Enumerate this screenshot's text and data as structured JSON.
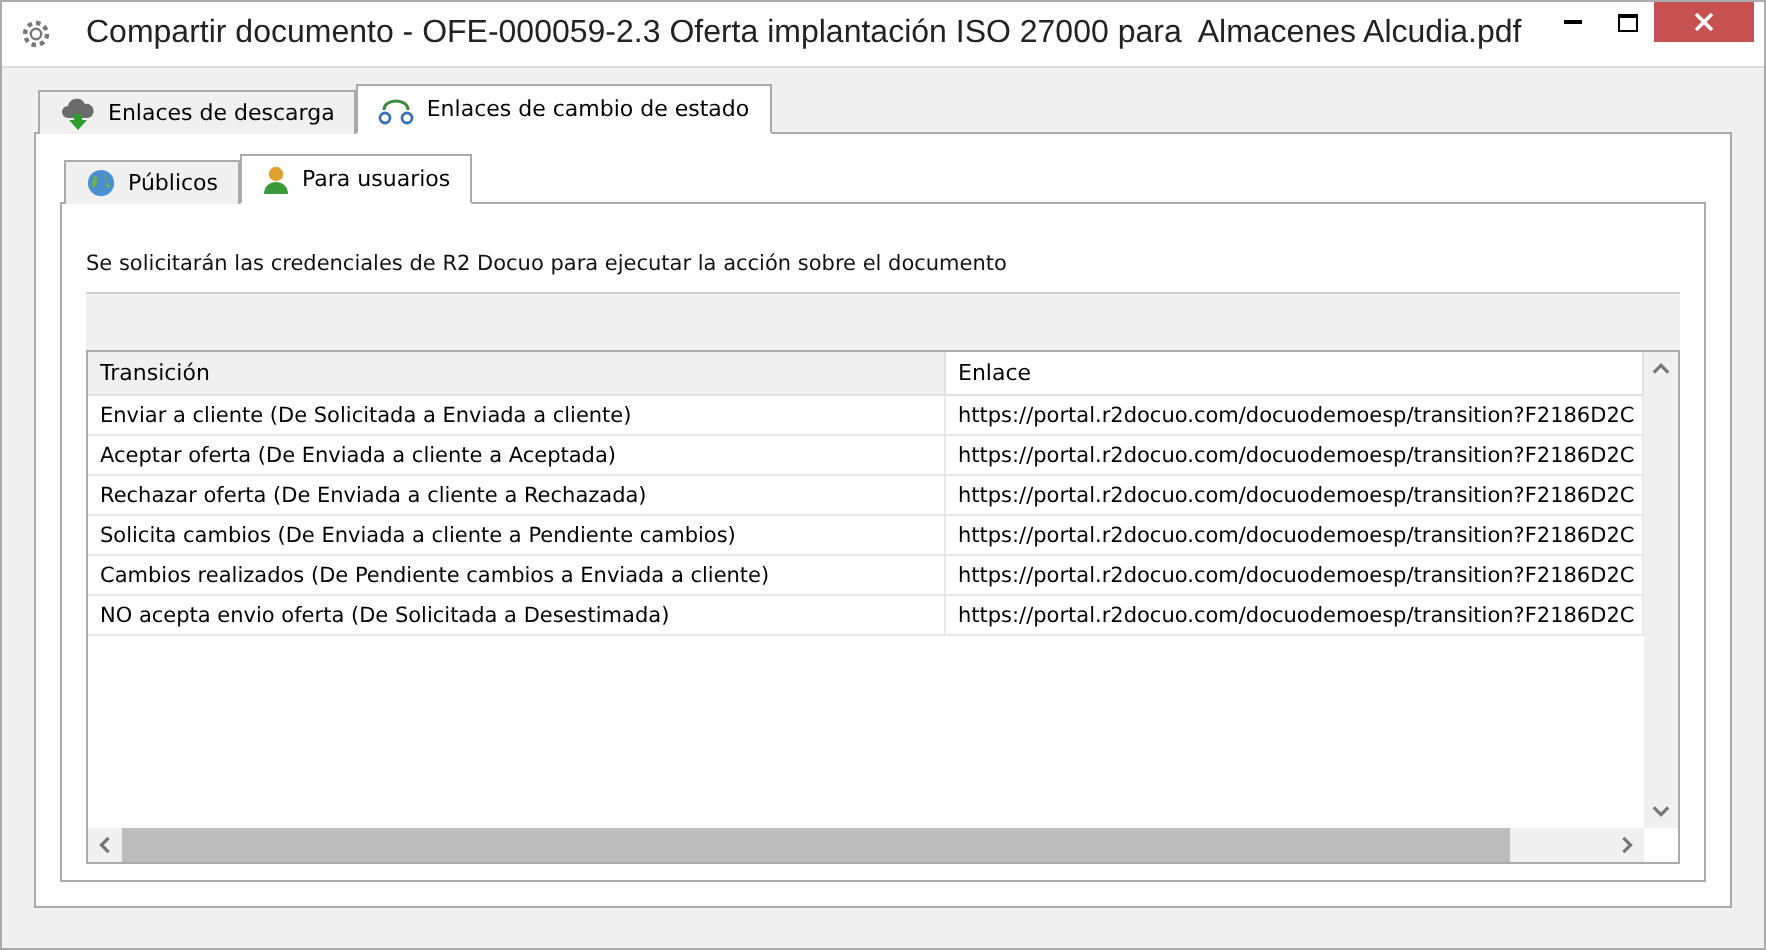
{
  "window": {
    "title": "Compartir documento - OFE-000059-2.3 Oferta implantación ISO 27000 para  Almacenes Alcudia.pdf"
  },
  "tabs": [
    {
      "label": "Enlaces de descarga",
      "selected": false,
      "kind": "download"
    },
    {
      "label": "Enlaces de cambio de estado",
      "selected": true,
      "kind": "transition"
    }
  ],
  "subtabs": [
    {
      "label": "Públicos",
      "selected": false,
      "kind": "globe"
    },
    {
      "label": "Para usuarios",
      "selected": true,
      "kind": "user"
    }
  ],
  "notice": "Se solicitarán las credenciales de R2 Docuo para ejecutar la acción sobre el documento",
  "table": {
    "columns": [
      "Transición",
      "Enlace"
    ],
    "rows": [
      [
        "Enviar a cliente (De Solicitada a Enviada a cliente)",
        "https://portal.r2docuo.com/docuodemoesp/transition?F2186D2C"
      ],
      [
        "Aceptar oferta (De Enviada a cliente a Aceptada)",
        "https://portal.r2docuo.com/docuodemoesp/transition?F2186D2C"
      ],
      [
        "Rechazar oferta (De Enviada a cliente a Rechazada)",
        "https://portal.r2docuo.com/docuodemoesp/transition?F2186D2C"
      ],
      [
        "Solicita cambios (De Enviada a cliente a Pendiente cambios)",
        "https://portal.r2docuo.com/docuodemoesp/transition?F2186D2C"
      ],
      [
        "Cambios realizados (De Pendiente cambios a Enviada a cliente)",
        "https://portal.r2docuo.com/docuodemoesp/transition?F2186D2C"
      ],
      [
        "NO acepta envio oferta (De Solicitada a Desestimada)",
        "https://portal.r2docuo.com/docuodemoesp/transition?F2186D2C"
      ]
    ]
  }
}
